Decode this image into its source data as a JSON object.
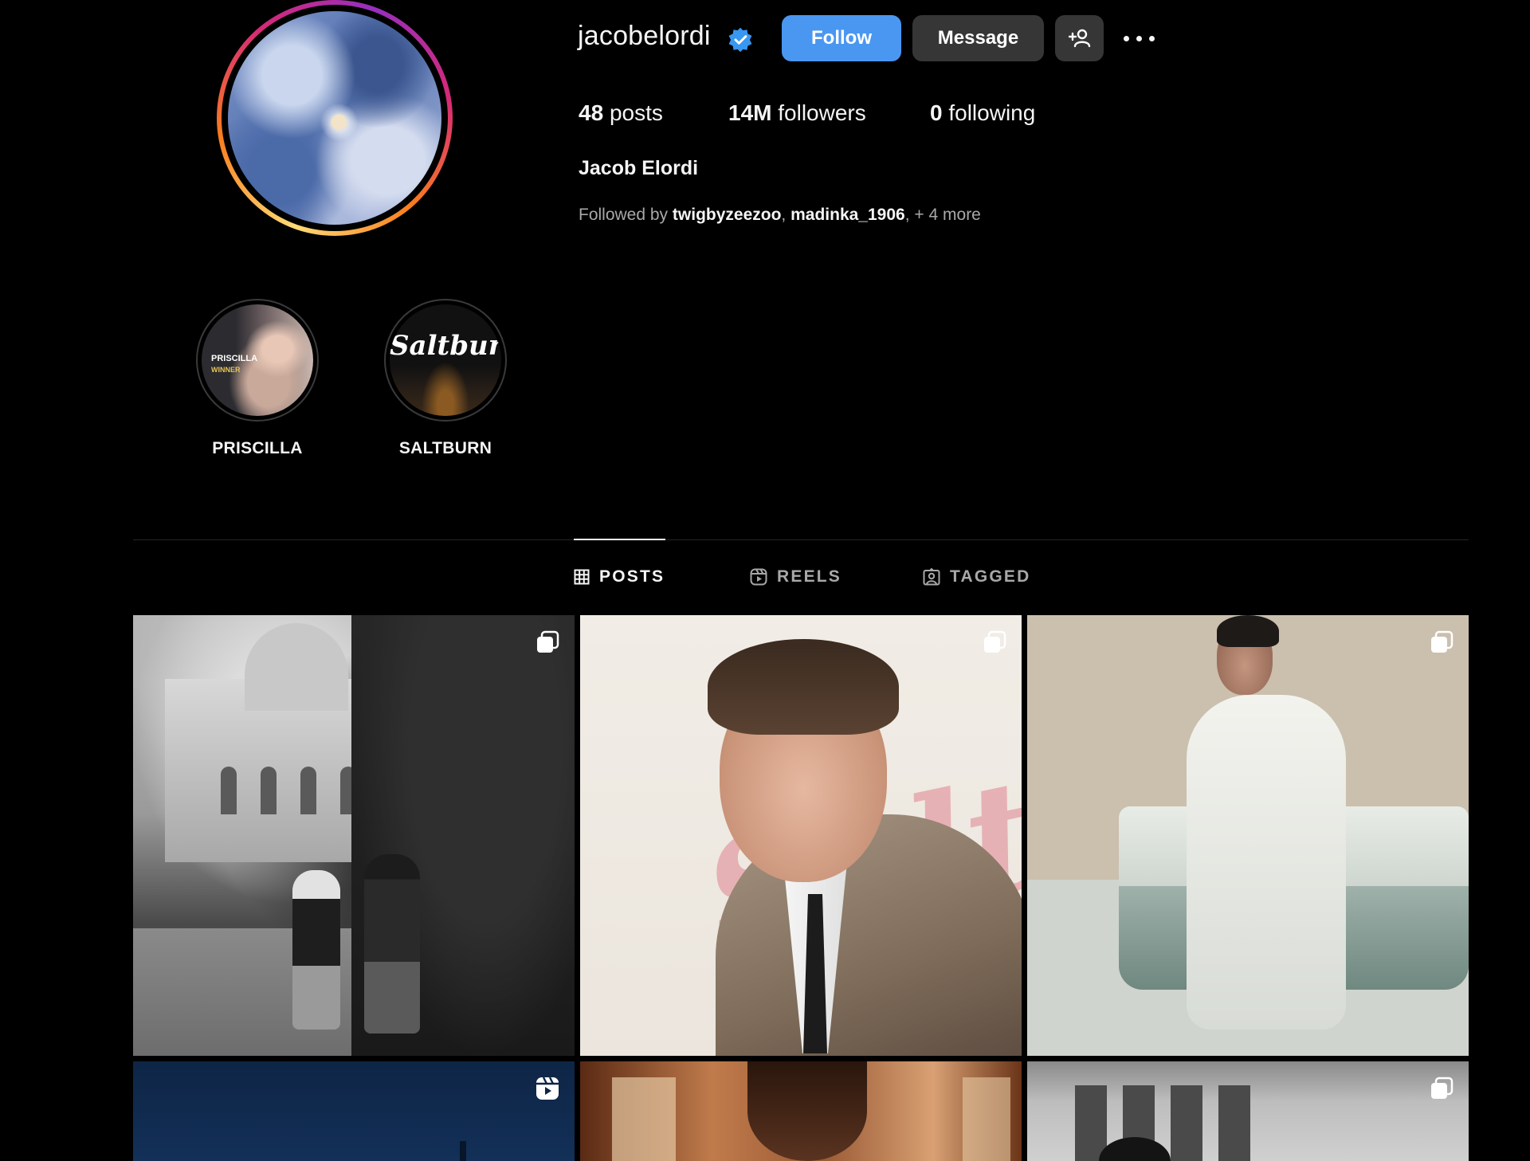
{
  "profile": {
    "username": "jacobelordi",
    "verified": true,
    "full_name": "Jacob Elordi",
    "buttons": {
      "follow": "Follow",
      "message": "Message"
    },
    "stats": {
      "posts_count": "48",
      "posts_label": "posts",
      "followers_count": "14M",
      "followers_label": "followers",
      "following_count": "0",
      "following_label": "following"
    },
    "followed_by": {
      "prefix": "Followed by",
      "users": [
        "twigbyzeezoo",
        "madinka_1906"
      ],
      "more": "+ 4 more"
    }
  },
  "highlights": [
    {
      "label": "PRISCILLA",
      "cover_text": "PRISCILLA",
      "cover_subtext": "WINNER"
    },
    {
      "label": "SALTBURN",
      "cover_text": "Saltburn"
    }
  ],
  "tabs": [
    {
      "label": "POSTS",
      "icon": "grid-icon",
      "active": true
    },
    {
      "label": "REELS",
      "icon": "reels-icon",
      "active": false
    },
    {
      "label": "TAGGED",
      "icon": "tagged-icon",
      "active": false
    }
  ],
  "posts": [
    {
      "badge": "carousel-icon"
    },
    {
      "badge": "carousel-icon",
      "cover_text": "Saltburn"
    },
    {
      "badge": "carousel-icon"
    },
    {
      "badge": "reel-icon"
    },
    {
      "badge": null
    },
    {
      "badge": "carousel-icon"
    }
  ],
  "colors": {
    "background": "#000000",
    "follow_button": "#4a97f1",
    "secondary_button": "#363636",
    "verified_badge": "#3897f0",
    "muted_text": "#a8a8a8"
  }
}
